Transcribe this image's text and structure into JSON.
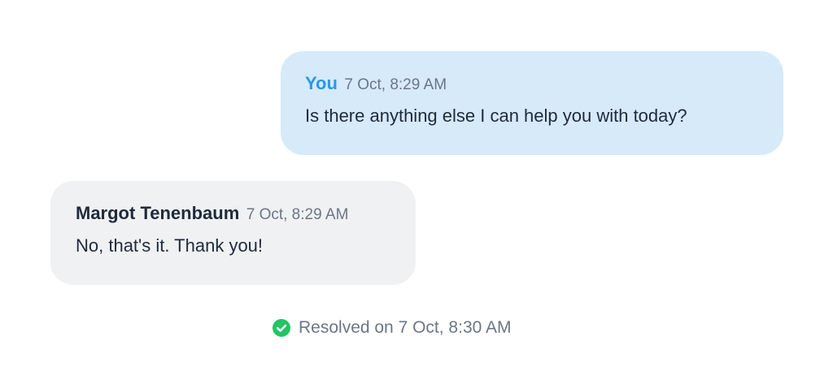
{
  "messages": [
    {
      "sender": "You",
      "time": "7 Oct, 8:29 AM",
      "text": "Is there anything else I can help you with today?"
    },
    {
      "sender": "Margot Tenenbaum",
      "time": "7 Oct, 8:29 AM",
      "text": "No, that's it. Thank you!"
    }
  ],
  "status": {
    "icon": "check-circle-icon",
    "text": "Resolved on 7 Oct, 8:30 AM",
    "color": "#22c463"
  },
  "colors": {
    "outgoing_bubble": "#d6eaf9",
    "incoming_bubble": "#f0f1f3",
    "accent": "#2b98e5"
  }
}
